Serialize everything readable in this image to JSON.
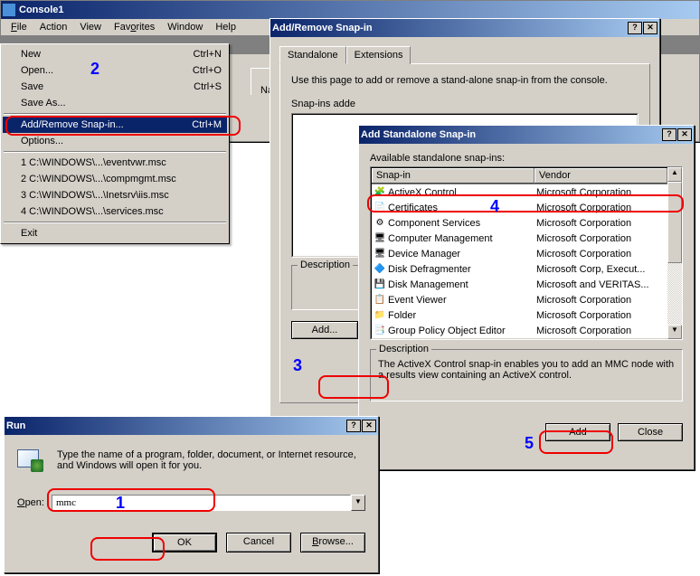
{
  "console": {
    "title": "Console1",
    "menus": {
      "file": "File",
      "action": "Action",
      "view": "View",
      "favorites": "Favorites",
      "window": "Window",
      "help": "Help"
    },
    "panel_header": "Nam"
  },
  "file_menu": {
    "new": {
      "label": "New",
      "sc": "Ctrl+N"
    },
    "open": {
      "label": "Open...",
      "sc": "Ctrl+O"
    },
    "save": {
      "label": "Save",
      "sc": "Ctrl+S"
    },
    "saveas": {
      "label": "Save As..."
    },
    "addremove": {
      "label": "Add/Remove Snap-in...",
      "sc": "Ctrl+M"
    },
    "options": {
      "label": "Options..."
    },
    "recent": [
      "1 C:\\WINDOWS\\...\\eventvwr.msc",
      "2 C:\\WINDOWS\\...\\compmgmt.msc",
      "3 C:\\WINDOWS\\...\\Inetsrv\\iis.msc",
      "4 C:\\WINDOWS\\...\\services.msc"
    ],
    "exit": "Exit"
  },
  "addremove_dlg": {
    "title": "Add/Remove Snap-in",
    "tab_standalone": "Standalone",
    "tab_extensions": "Extensions",
    "intro": "Use this page to add or remove a stand-alone snap-in from the console.",
    "snapins_added": "Snap-ins adde",
    "description_label": "Description",
    "add_btn": "Add..."
  },
  "standalone_dlg": {
    "title": "Add Standalone Snap-in",
    "available_label": "Available standalone snap-ins:",
    "col_snapin": "Snap-in",
    "col_vendor": "Vendor",
    "rows": [
      {
        "name": "ActiveX Control",
        "vendor": "Microsoft Corporation",
        "icon": "🧩"
      },
      {
        "name": "Certificates",
        "vendor": "Microsoft Corporation",
        "icon": "📄"
      },
      {
        "name": "Component Services",
        "vendor": "Microsoft Corporation",
        "icon": "⚙"
      },
      {
        "name": "Computer Management",
        "vendor": "Microsoft Corporation",
        "icon": "🖥"
      },
      {
        "name": "Device Manager",
        "vendor": "Microsoft Corporation",
        "icon": "🖥"
      },
      {
        "name": "Disk Defragmenter",
        "vendor": "Microsoft Corp, Execut...",
        "icon": "🔷"
      },
      {
        "name": "Disk Management",
        "vendor": "Microsoft and VERITAS...",
        "icon": "💾"
      },
      {
        "name": "Event Viewer",
        "vendor": "Microsoft Corporation",
        "icon": "📋"
      },
      {
        "name": "Folder",
        "vendor": "Microsoft Corporation",
        "icon": "📁"
      },
      {
        "name": "Group Policy Object Editor",
        "vendor": "Microsoft Corporation",
        "icon": "📑"
      }
    ],
    "desc_label": "Description",
    "desc_text": "The ActiveX Control snap-in enables you to add an MMC node with a results view containing an ActiveX control.",
    "add_btn": "Add",
    "close_btn": "Close"
  },
  "run_dlg": {
    "title": "Run",
    "intro": "Type the name of a program, folder, document, or Internet resource, and Windows will open it for you.",
    "open_label": "Open:",
    "value": "mmc",
    "ok": "OK",
    "cancel": "Cancel",
    "browse": "Browse..."
  },
  "annotations": {
    "1": "1",
    "2": "2",
    "3": "3",
    "4": "4",
    "5": "5"
  }
}
